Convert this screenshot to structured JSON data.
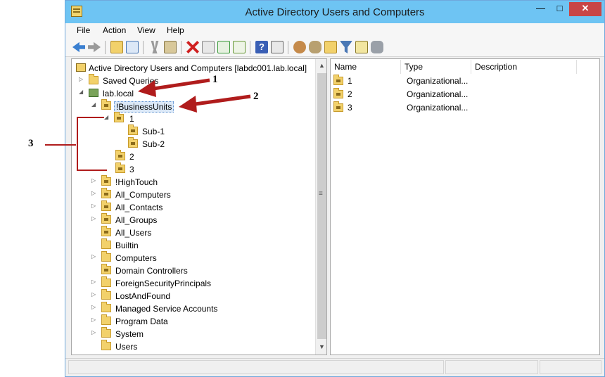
{
  "window": {
    "title": "Active Directory Users and Computers",
    "controls": {
      "minimize": "—",
      "maximize": "□",
      "close": "✕"
    }
  },
  "menu": {
    "items": [
      "File",
      "Action",
      "View",
      "Help"
    ]
  },
  "toolbar": {
    "buttons": [
      "back-icon",
      "forward-icon",
      "up-folder-icon",
      "show-tree-icon",
      "cut-icon",
      "copy-icon",
      "delete-icon",
      "properties-icon",
      "refresh-icon",
      "export-icon",
      "help-icon",
      "console-icon",
      "new-user-icon",
      "new-group-icon",
      "new-ou-icon",
      "filter-icon",
      "find-icon",
      "delegate-icon"
    ]
  },
  "tree": {
    "root": "Active Directory Users and Computers [labdc001.lab.local]",
    "saved_queries": "Saved Queries",
    "domain": "lab.local",
    "business_units": "!BusinessUnits",
    "bu_children": [
      "1",
      "Sub-1",
      "Sub-2",
      "2",
      "3"
    ],
    "ous": [
      "!HighTouch",
      "All_Computers",
      "All_Contacts",
      "All_Groups",
      "All_Users",
      "Builtin",
      "Computers",
      "Domain Controllers",
      "ForeignSecurityPrincipals",
      "LostAndFound",
      "Managed Service Accounts",
      "Program Data",
      "System",
      "Users"
    ]
  },
  "list": {
    "columns": [
      "Name",
      "Type",
      "Description"
    ],
    "rows": [
      {
        "name": "1",
        "type": "Organizational...",
        "description": ""
      },
      {
        "name": "2",
        "type": "Organizational...",
        "description": ""
      },
      {
        "name": "3",
        "type": "Organizational...",
        "description": ""
      }
    ]
  },
  "annotations": {
    "a1": "1",
    "a2": "2",
    "a3": "3"
  },
  "colors": {
    "titlebar": "#6ec4f3",
    "close": "#c84545",
    "arrow": "#b01c1c",
    "folder": "#f2d16b"
  }
}
